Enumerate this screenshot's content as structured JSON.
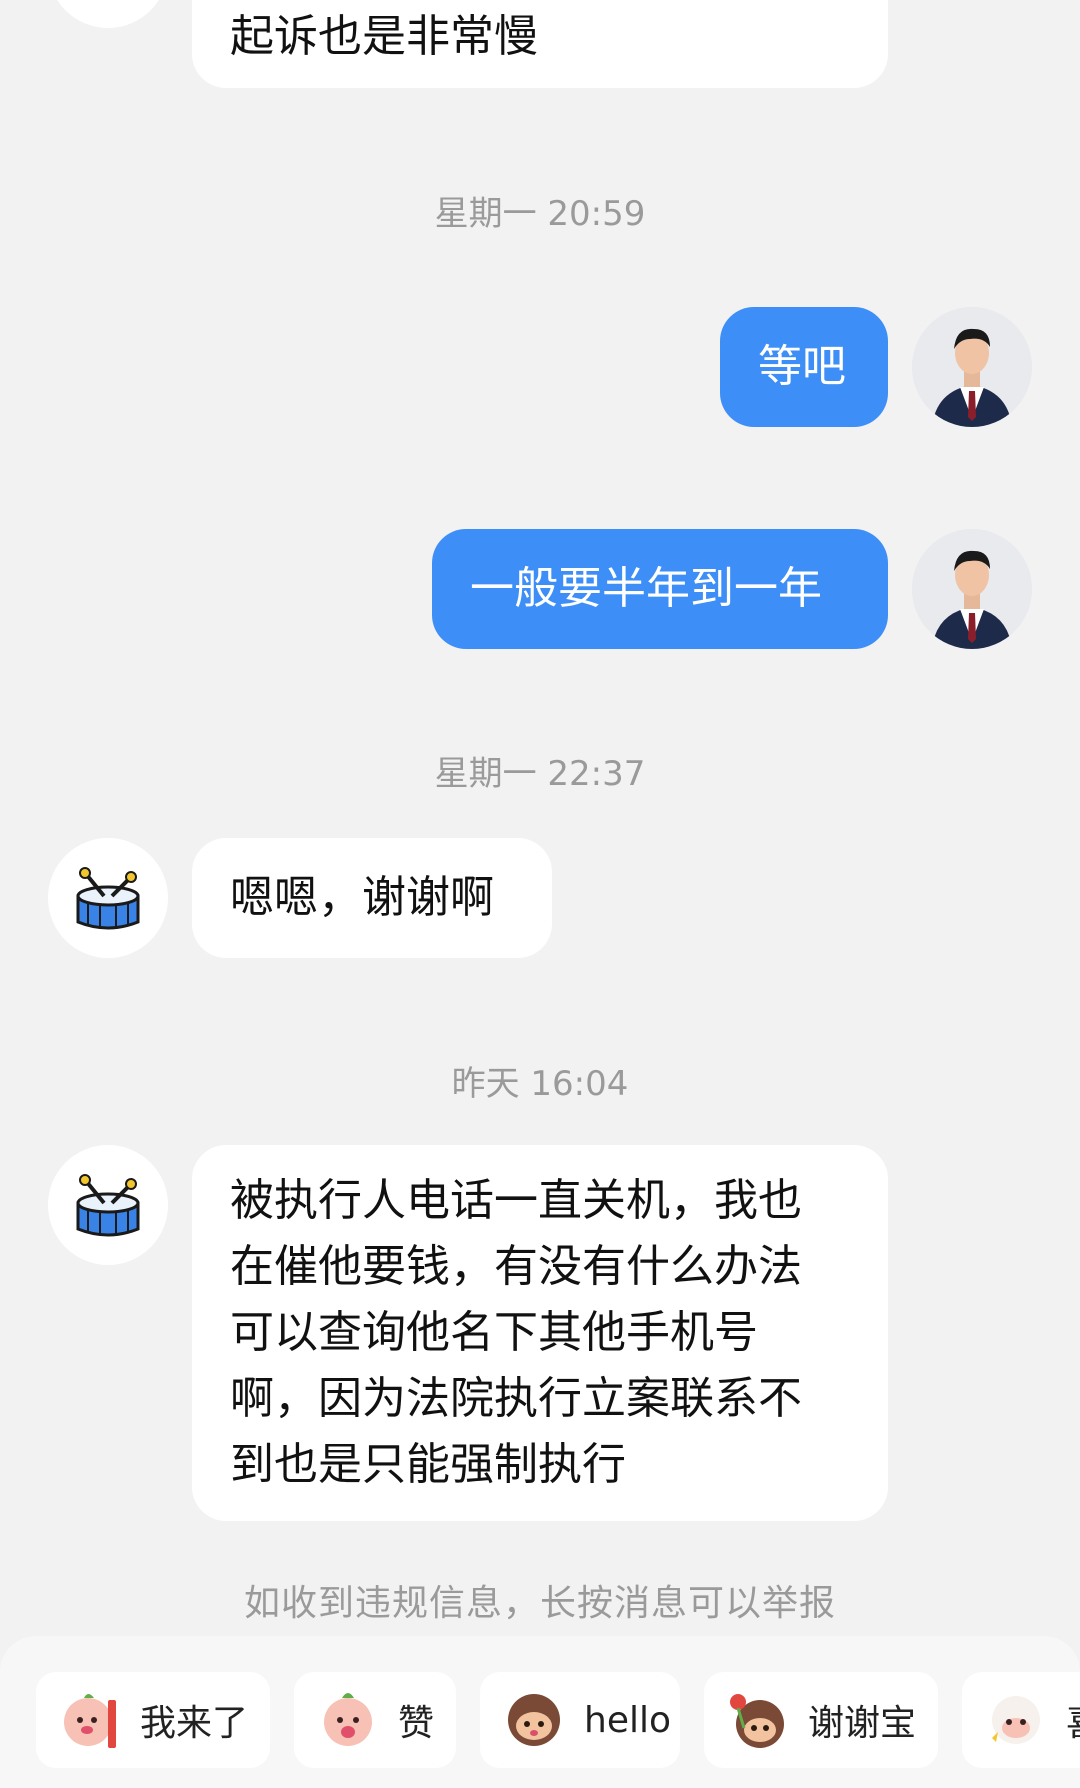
{
  "messages": {
    "m0": "起诉也是非常慢",
    "t1": "星期一 20:59",
    "m1": "等吧",
    "m2": "一般要半年到一年",
    "t2": "星期一 22:37",
    "m3": "嗯嗯，谢谢啊",
    "t3": "昨天 16:04",
    "m4_lines": [
      "被执行人电话一直关机，我也",
      "在催他要钱，有没有什么办法",
      "可以查询他名下其他手机号",
      "啊，因为法院执行立案联系不",
      "到也是只能强制执行"
    ]
  },
  "notice": "如收到违规信息，长按消息可以举报",
  "quick_replies": [
    "我来了",
    "赞",
    "hello",
    "谢谢宝",
    "喜"
  ],
  "colors": {
    "accent": "#3e8ef7",
    "background": "#f2f2f2",
    "bubble_in": "#ffffff"
  },
  "icons": {
    "contact_avatar": "drum-icon",
    "self_avatar": "lawyer-portrait"
  }
}
